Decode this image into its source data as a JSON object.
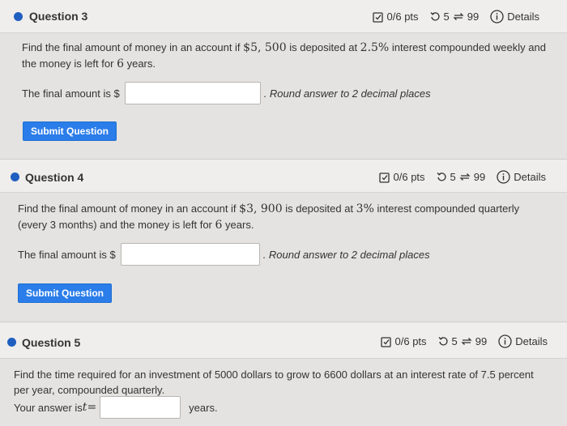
{
  "questions": [
    {
      "title": "Question 3",
      "pts": "0/6 pts",
      "tries": "5",
      "retries": "99",
      "details": "Details",
      "prompt_a": "Find the final amount of money in an account if ",
      "amount": "$5, 500",
      "prompt_b": " is deposited at ",
      "rate": "2.5%",
      "prompt_c": " interest compounded weekly and the money is left for ",
      "years": "6",
      "prompt_d": " years.",
      "answer_label": "The final amount is $",
      "answer_value": "",
      "hint": ". Round answer to 2 decimal places",
      "submit": "Submit Question"
    },
    {
      "title": "Question 4",
      "pts": "0/6 pts",
      "tries": "5",
      "retries": "99",
      "details": "Details",
      "prompt_a": "Find the final amount of money in an account if ",
      "amount": "$3, 900",
      "prompt_b": " is deposited at ",
      "rate": "3%",
      "prompt_c": " interest compounded quarterly (every 3 months) and the money is left for ",
      "years": "6",
      "prompt_d": " years.",
      "answer_label": "The final amount is $",
      "answer_value": "",
      "hint": ". Round answer to 2 decimal places",
      "submit": "Submit Question"
    },
    {
      "title": "Question 5",
      "pts": "0/6 pts",
      "tries": "5",
      "retries": "99",
      "details": "Details",
      "prompt": "Find the time required for an investment of 5000 dollars to grow to 6600 dollars at an interest rate of 7.5 percent per year, compounded quarterly.",
      "answer_label": "Your answer is ",
      "variable": "t",
      "equals": " =",
      "answer_value": "",
      "unit": "years."
    }
  ],
  "colors": {
    "accent": "#1f5fbf",
    "button": "#2b7de9",
    "background": "#e4e3e1"
  },
  "icons": [
    "edit-checkbox-icon",
    "retry-icon",
    "resubmit-icon",
    "info-icon"
  ]
}
